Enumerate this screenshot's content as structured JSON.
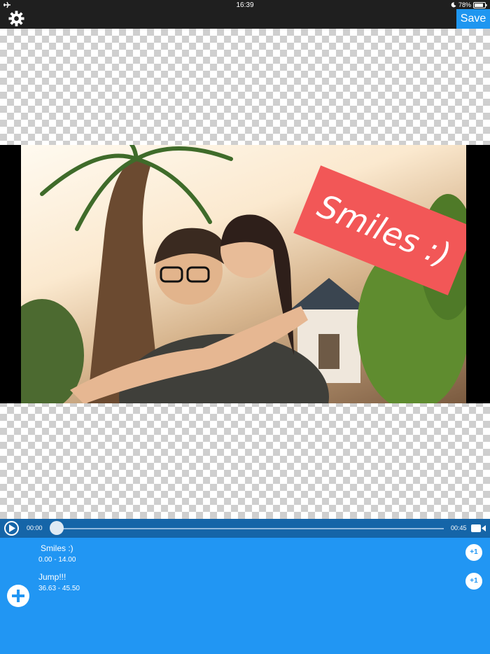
{
  "status_bar": {
    "time": "16:39",
    "battery": "78%"
  },
  "toolbar": {
    "save_label": "Save"
  },
  "canvas": {
    "sticker_text": "Smiles :)"
  },
  "player": {
    "current_time": "00:00",
    "duration": "00:45",
    "progress": 0.0
  },
  "stickers": [
    {
      "name": "Smiles :)",
      "range": "0.00 - 14.00",
      "action_label": "+1"
    },
    {
      "name": "Jump!!!",
      "range": "36.63 - 45.50",
      "action_label": "+1"
    }
  ],
  "colors": {
    "accent": "#2196f3",
    "player_bar": "#1565a8",
    "sticker": "#f25757"
  }
}
